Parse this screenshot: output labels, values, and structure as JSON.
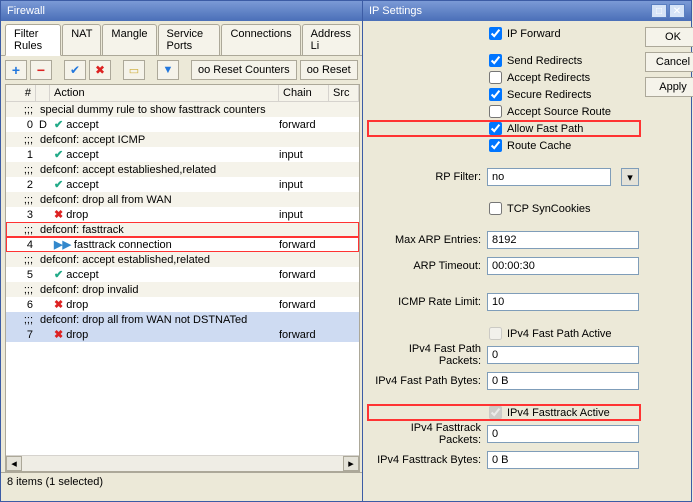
{
  "firewall": {
    "title": "Firewall",
    "tabs": [
      "Filter Rules",
      "NAT",
      "Mangle",
      "Service Ports",
      "Connections",
      "Address Li"
    ],
    "active_tab": 0,
    "toolbar": {
      "reset_counters": "Reset Counters",
      "reset": "Reset"
    },
    "columns": {
      "num": "#",
      "action": "Action",
      "chain": "Chain",
      "src": "Src"
    },
    "rows": [
      {
        "type": "comment",
        "text": "special dummy rule to show fasttrack counters"
      },
      {
        "type": "rule",
        "num": "0",
        "flag": "D",
        "icon": "accept",
        "action": "accept",
        "chain": "forward"
      },
      {
        "type": "comment",
        "text": "defconf: accept ICMP"
      },
      {
        "type": "rule",
        "num": "1",
        "flag": "",
        "icon": "accept",
        "action": "accept",
        "chain": "input"
      },
      {
        "type": "comment",
        "text": "defconf: accept establieshed,related"
      },
      {
        "type": "rule",
        "num": "2",
        "flag": "",
        "icon": "accept",
        "action": "accept",
        "chain": "input"
      },
      {
        "type": "comment",
        "text": "defconf: drop all from WAN"
      },
      {
        "type": "rule",
        "num": "3",
        "flag": "",
        "icon": "drop",
        "action": "drop",
        "chain": "input"
      },
      {
        "type": "comment",
        "text": "defconf: fasttrack",
        "hl": true
      },
      {
        "type": "rule",
        "num": "4",
        "flag": "",
        "icon": "ft",
        "action": "fasttrack connection",
        "chain": "forward",
        "hl": true
      },
      {
        "type": "comment",
        "text": "defconf: accept established,related"
      },
      {
        "type": "rule",
        "num": "5",
        "flag": "",
        "icon": "accept",
        "action": "accept",
        "chain": "forward"
      },
      {
        "type": "comment",
        "text": "defconf: drop invalid"
      },
      {
        "type": "rule",
        "num": "6",
        "flag": "",
        "icon": "drop",
        "action": "drop",
        "chain": "forward"
      },
      {
        "type": "comment",
        "text": "defconf:  drop all from WAN not DSTNATed",
        "sel": true
      },
      {
        "type": "rule",
        "num": "7",
        "flag": "",
        "icon": "drop",
        "action": "drop",
        "chain": "forward",
        "sel": true
      }
    ],
    "status": "8 items (1 selected)",
    "counter_prefix": "oo"
  },
  "ip": {
    "title": "IP Settings",
    "buttons": {
      "ok": "OK",
      "cancel": "Cancel",
      "apply": "Apply"
    },
    "check": {
      "ip_forward": "IP Forward",
      "send_redirects": "Send Redirects",
      "accept_redirects": "Accept Redirects",
      "secure_redirects": "Secure Redirects",
      "accept_source_route": "Accept Source Route",
      "allow_fast_path": "Allow Fast Path",
      "route_cache": "Route Cache",
      "tcp_syncookies": "TCP SynCookies",
      "ipv4_fast_path_active": "IPv4 Fast Path Active",
      "ipv4_fasttrack_active": "IPv4 Fasttrack Active"
    },
    "labels": {
      "rp_filter": "RP Filter:",
      "max_arp": "Max ARP Entries:",
      "arp_timeout": "ARP Timeout:",
      "icmp_rate": "ICMP Rate Limit:",
      "fp_packets": "IPv4 Fast Path Packets:",
      "fp_bytes": "IPv4 Fast Path Bytes:",
      "ft_packets": "IPv4 Fasttrack Packets:",
      "ft_bytes": "IPv4 Fasttrack Bytes:"
    },
    "values": {
      "rp_filter": "no",
      "max_arp": "8192",
      "arp_timeout": "00:00:30",
      "icmp_rate": "10",
      "fp_packets": "0",
      "fp_bytes": "0 B",
      "ft_packets": "0",
      "ft_bytes": "0 B"
    },
    "checked": {
      "ip_forward": true,
      "send_redirects": true,
      "accept_redirects": false,
      "secure_redirects": true,
      "accept_source_route": false,
      "allow_fast_path": true,
      "route_cache": true,
      "tcp_syncookies": false,
      "ipv4_fast_path_active": false,
      "ipv4_fasttrack_active": true
    }
  }
}
